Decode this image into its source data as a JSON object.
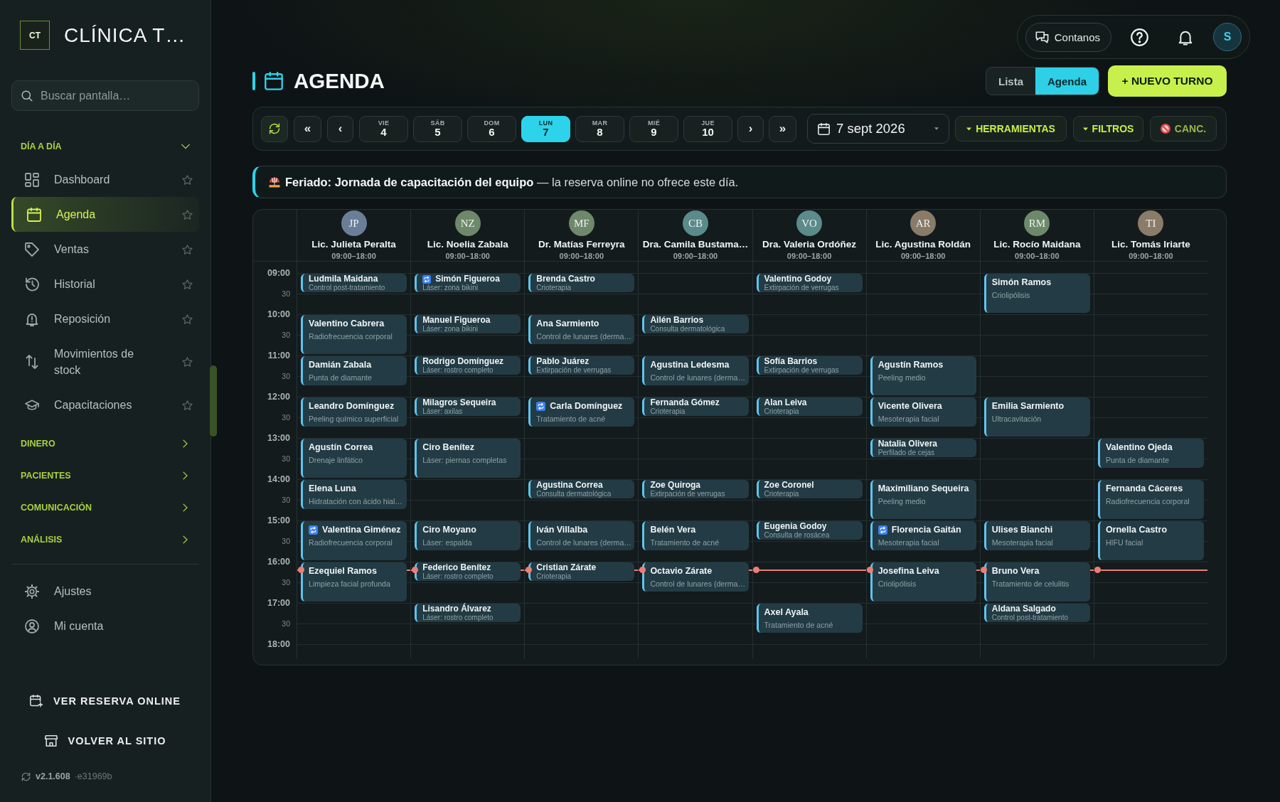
{
  "sidebar": {
    "brand": {
      "logo": "CT",
      "name": "CLÍNICA T…"
    },
    "search": {
      "placeholder": "Buscar pantalla…"
    },
    "sections": [
      {
        "label": "DÍA A DÍA",
        "expanded": true,
        "items": [
          {
            "label": "Dashboard",
            "selected": false,
            "favorite": false
          },
          {
            "label": "Agenda",
            "selected": true,
            "favorite": false
          },
          {
            "label": "Ventas",
            "selected": false,
            "favorite": false
          },
          {
            "label": "Historial",
            "selected": false,
            "favorite": false
          },
          {
            "label": "Reposición",
            "selected": false,
            "favorite": false
          },
          {
            "label": "Movimientos de stock",
            "selected": false,
            "favorite": false
          },
          {
            "label": "Capacitaciones",
            "selected": false,
            "favorite": false
          }
        ]
      },
      {
        "label": "DINERO",
        "expanded": false
      },
      {
        "label": "PACIENTES",
        "expanded": false
      },
      {
        "label": "COMUNICACIÓN",
        "expanded": false
      },
      {
        "label": "ANÁLISIS",
        "expanded": false
      }
    ],
    "account_items": [
      {
        "label": "Ajustes",
        "selected": false
      },
      {
        "label": "Mi cuenta",
        "selected": false
      }
    ],
    "links": [
      {
        "label": "VER RESERVA ONLINE"
      },
      {
        "label": "VOLVER AL SITIO"
      }
    ],
    "version": "v2.1.608",
    "commit": "·e31969b"
  },
  "topbar": {
    "feedback_button": "Contanos",
    "user_initial": "S"
  },
  "page_header": {
    "title": "AGENDA",
    "views": [
      {
        "label": "Lista",
        "selected": false
      },
      {
        "label": "Agenda",
        "selected": true
      }
    ],
    "new_button": "+ NUEVO TURNO"
  },
  "toolbar": {
    "back_buttons": [
      "«",
      "‹"
    ],
    "days": [
      {
        "weekday": "VIE",
        "day": "4",
        "selected": false
      },
      {
        "weekday": "SÁB",
        "day": "5",
        "selected": false
      },
      {
        "weekday": "DOM",
        "day": "6",
        "selected": false
      },
      {
        "weekday": "LUN",
        "day": "7",
        "selected": true
      },
      {
        "weekday": "MAR",
        "day": "8",
        "selected": false
      },
      {
        "weekday": "MIÉ",
        "day": "9",
        "selected": false
      },
      {
        "weekday": "JUE",
        "day": "10",
        "selected": false
      }
    ],
    "forward_buttons": [
      "›",
      "»"
    ],
    "date": "7 sept 2026",
    "menus": [
      {
        "label": "HERRAMIENTAS"
      },
      {
        "label": "FILTROS"
      }
    ],
    "cancelled_toggle": {
      "label": "CANC.",
      "on": false
    }
  },
  "notice": {
    "text": "**Feriado: Jornada de capacitación del equipo** — la reserva online no ofrece este día."
  },
  "calendar": {
    "time_labels": [
      "09:00",
      "30",
      "10:00",
      "30",
      "11:00",
      "30",
      "12:00",
      "30",
      "13:00",
      "30",
      "14:00",
      "30",
      "15:00",
      "30",
      "16:00",
      "30",
      "17:00",
      "30",
      "18:00"
    ],
    "now_line": {
      "level": 0.2
    },
    "staff": [
      {
        "initials": "JP",
        "color": "#6b7e98",
        "name": "Lic. Julieta Peralta",
        "hours": "09:00–18:00",
        "slots": [
          {
            "kind": "short",
            "patient": "Ludmila Maidana",
            "service": "Control post-tratamiento",
            "recurring": false
          },
          {
            "kind": "free"
          },
          {
            "kind": "long",
            "patient": "Valentino Cabrera",
            "service": "Radiofrecuencia corporal",
            "recurring": false
          },
          {
            "kind": "medium",
            "patient": "Damián Zabala",
            "service": "Punta de diamante",
            "recurring": false
          },
          {
            "kind": "medium",
            "patient": "Leandro Domínguez",
            "service": "Peeling químico superficial",
            "recurring": false
          },
          {
            "kind": "long",
            "patient": "Agustín Correa",
            "service": "Drenaje linfático",
            "recurring": false
          },
          {
            "kind": "medium",
            "patient": "Elena Luna",
            "service": "Hidratación con ácido hial…",
            "recurring": false
          },
          {
            "kind": "long",
            "patient": "Valentina Giménez",
            "service": "Radiofrecuencia corporal",
            "recurring": true
          },
          {
            "kind": "long",
            "patient": "Ezequiel Ramos",
            "service": "Limpieza facial profunda",
            "recurring": false
          },
          {
            "kind": "free"
          },
          {
            "kind": "free"
          }
        ]
      },
      {
        "initials": "NZ",
        "color": "#6e886a",
        "name": "Lic. Noelia Zabala",
        "hours": "09:00–18:00",
        "slots": [
          {
            "kind": "short",
            "patient": "Simón Figueroa",
            "service": "Láser: zona bikini",
            "recurring": true
          },
          {
            "kind": "free"
          },
          {
            "kind": "short",
            "patient": "Manuel Figueroa",
            "service": "Láser: zona bikini",
            "recurring": false
          },
          {
            "kind": "free"
          },
          {
            "kind": "short",
            "patient": "Rodrigo Domínguez",
            "service": "Láser: rostro completo",
            "recurring": false
          },
          {
            "kind": "free"
          },
          {
            "kind": "short",
            "patient": "Milagros Sequeira",
            "service": "Láser: axilas",
            "recurring": false
          },
          {
            "kind": "free"
          },
          {
            "kind": "long",
            "patient": "Ciro Benítez",
            "service": "Láser: piernas completas",
            "recurring": false
          },
          {
            "kind": "free"
          },
          {
            "kind": "free"
          },
          {
            "kind": "medium",
            "patient": "Ciro Moyano",
            "service": "Láser: espalda",
            "recurring": false
          },
          {
            "kind": "short",
            "patient": "Federico Benítez",
            "service": "Láser: rostro completo",
            "recurring": false
          },
          {
            "kind": "free"
          },
          {
            "kind": "short",
            "patient": "Lisandro Álvarez",
            "service": "Láser: rostro completo",
            "recurring": false
          },
          {
            "kind": "free"
          }
        ]
      },
      {
        "initials": "MF",
        "color": "#6f886b",
        "name": "Dr. Matías Ferreyra",
        "hours": "09:00–18:00",
        "slots": [
          {
            "kind": "short",
            "patient": "Brenda Castro",
            "service": "Crioterapia",
            "recurring": false
          },
          {
            "kind": "free"
          },
          {
            "kind": "medium",
            "patient": "Ana Sarmiento",
            "service": "Control de lunares (derma…",
            "recurring": false
          },
          {
            "kind": "short",
            "patient": "Pablo Juárez",
            "service": "Extirpación de verrugas",
            "recurring": false
          },
          {
            "kind": "free"
          },
          {
            "kind": "medium",
            "patient": "Carla Domínguez",
            "service": "Tratamiento de acné",
            "recurring": true
          },
          {
            "kind": "free"
          },
          {
            "kind": "free"
          },
          {
            "kind": "short",
            "patient": "Agustina Correa",
            "service": "Consulta dermatológica",
            "recurring": false
          },
          {
            "kind": "free"
          },
          {
            "kind": "medium",
            "patient": "Iván Villalba",
            "service": "Control de lunares (derma…",
            "recurring": false
          },
          {
            "kind": "short",
            "patient": "Cristian Zárate",
            "service": "Crioterapia",
            "recurring": false
          },
          {
            "kind": "free"
          },
          {
            "kind": "free"
          },
          {
            "kind": "free"
          }
        ]
      },
      {
        "initials": "CB",
        "color": "#5a8a89",
        "name": "Dra. Camila Bustama…",
        "hours": "09:00–18:00",
        "slots": [
          {
            "kind": "free"
          },
          {
            "kind": "free"
          },
          {
            "kind": "short",
            "patient": "Ailén Barrios",
            "service": "Consulta dermatológica",
            "recurring": false
          },
          {
            "kind": "free"
          },
          {
            "kind": "medium",
            "patient": "Agustina Ledesma",
            "service": "Control de lunares (derma…",
            "recurring": false
          },
          {
            "kind": "short",
            "patient": "Fernanda Gómez",
            "service": "Crioterapia",
            "recurring": false
          },
          {
            "kind": "free"
          },
          {
            "kind": "free"
          },
          {
            "kind": "free"
          },
          {
            "kind": "short",
            "patient": "Zoe Quiroga",
            "service": "Extirpación de verrugas",
            "recurring": false
          },
          {
            "kind": "free"
          },
          {
            "kind": "medium",
            "patient": "Belén Vera",
            "service": "Tratamiento de acné",
            "recurring": false
          },
          {
            "kind": "medium",
            "patient": "Octavio Zárate",
            "service": "Control de lunares (derma…",
            "recurring": false
          },
          {
            "kind": "free"
          },
          {
            "kind": "free"
          }
        ]
      },
      {
        "initials": "VO",
        "color": "#5b8b8a",
        "name": "Dra. Valeria Ordóñez",
        "hours": "09:00–18:00",
        "slots": [
          {
            "kind": "short",
            "patient": "Valentino Godoy",
            "service": "Extirpación de verrugas",
            "recurring": false
          },
          {
            "kind": "free"
          },
          {
            "kind": "free"
          },
          {
            "kind": "free"
          },
          {
            "kind": "short",
            "patient": "Sofía Barrios",
            "service": "Extirpación de verrugas",
            "recurring": false
          },
          {
            "kind": "free"
          },
          {
            "kind": "short",
            "patient": "Alan Leiva",
            "service": "Crioterapia",
            "recurring": false
          },
          {
            "kind": "free"
          },
          {
            "kind": "free"
          },
          {
            "kind": "free"
          },
          {
            "kind": "short",
            "patient": "Zoe Coronel",
            "service": "Crioterapia",
            "recurring": false
          },
          {
            "kind": "free"
          },
          {
            "kind": "short",
            "patient": "Eugenia Godoy",
            "service": "Consulta de rosácea",
            "recurring": false
          },
          {
            "kind": "free"
          },
          {
            "kind": "free"
          },
          {
            "kind": "free"
          },
          {
            "kind": "medium",
            "patient": "Axel Ayala",
            "service": "Tratamiento de acné",
            "recurring": false
          }
        ]
      },
      {
        "initials": "AR",
        "color": "#8a7b68",
        "name": "Lic. Agustina Roldán",
        "hours": "09:00–18:00",
        "slots": [
          {
            "kind": "free"
          },
          {
            "kind": "free"
          },
          {
            "kind": "free"
          },
          {
            "kind": "free"
          },
          {
            "kind": "long",
            "patient": "Agustín Ramos",
            "service": "Peeling medio",
            "recurring": false
          },
          {
            "kind": "medium",
            "patient": "Vicente Olivera",
            "service": "Mesoterapia facial",
            "recurring": false
          },
          {
            "kind": "short",
            "patient": "Natalia Olivera",
            "service": "Perfilado de cejas",
            "recurring": false
          },
          {
            "kind": "free"
          },
          {
            "kind": "long",
            "patient": "Maximiliano Sequeira",
            "service": "Peeling medio",
            "recurring": false
          },
          {
            "kind": "medium",
            "patient": "Florencia Gaitán",
            "service": "Mesoterapia facial",
            "recurring": true
          },
          {
            "kind": "long",
            "patient": "Josefina Leiva",
            "service": "Criolipólisis",
            "recurring": false
          },
          {
            "kind": "free"
          },
          {
            "kind": "free"
          }
        ]
      },
      {
        "initials": "RM",
        "color": "#6d896a",
        "name": "Lic. Rocío Maidana",
        "hours": "09:00–18:00",
        "slots": [
          {
            "kind": "long",
            "patient": "Simón Ramos",
            "service": "Criolipólisis",
            "recurring": false
          },
          {
            "kind": "free"
          },
          {
            "kind": "free"
          },
          {
            "kind": "free"
          },
          {
            "kind": "free"
          },
          {
            "kind": "long",
            "patient": "Emilia Sarmiento",
            "service": "Ultracavitación",
            "recurring": false
          },
          {
            "kind": "free"
          },
          {
            "kind": "free"
          },
          {
            "kind": "free"
          },
          {
            "kind": "free"
          },
          {
            "kind": "medium",
            "patient": "Ulises Bianchi",
            "service": "Mesoterapia facial",
            "recurring": false
          },
          {
            "kind": "long",
            "patient": "Bruno Vera",
            "service": "Tratamiento de celulitis",
            "recurring": false
          },
          {
            "kind": "short",
            "patient": "Aldana Salgado",
            "service": "Control post-tratamiento",
            "recurring": false
          },
          {
            "kind": "free"
          }
        ]
      },
      {
        "initials": "TI",
        "color": "#8b7c69",
        "name": "Lic. Tomás Iriarte",
        "hours": "09:00–18:00",
        "slots": [
          {
            "kind": "free"
          },
          {
            "kind": "free"
          },
          {
            "kind": "free"
          },
          {
            "kind": "free"
          },
          {
            "kind": "free"
          },
          {
            "kind": "free"
          },
          {
            "kind": "free"
          },
          {
            "kind": "free"
          },
          {
            "kind": "medium",
            "patient": "Valentino Ojeda",
            "service": "Punta de diamante",
            "recurring": false
          },
          {
            "kind": "long",
            "patient": "Fernanda Cáceres",
            "service": "Radiofrecuencia corporal",
            "recurring": false
          },
          {
            "kind": "long",
            "patient": "Ornella Castro",
            "service": "HIFU facial",
            "recurring": false
          },
          {
            "kind": "free"
          },
          {
            "kind": "free"
          },
          {
            "kind": "free"
          },
          {
            "kind": "free"
          }
        ]
      }
    ]
  }
}
